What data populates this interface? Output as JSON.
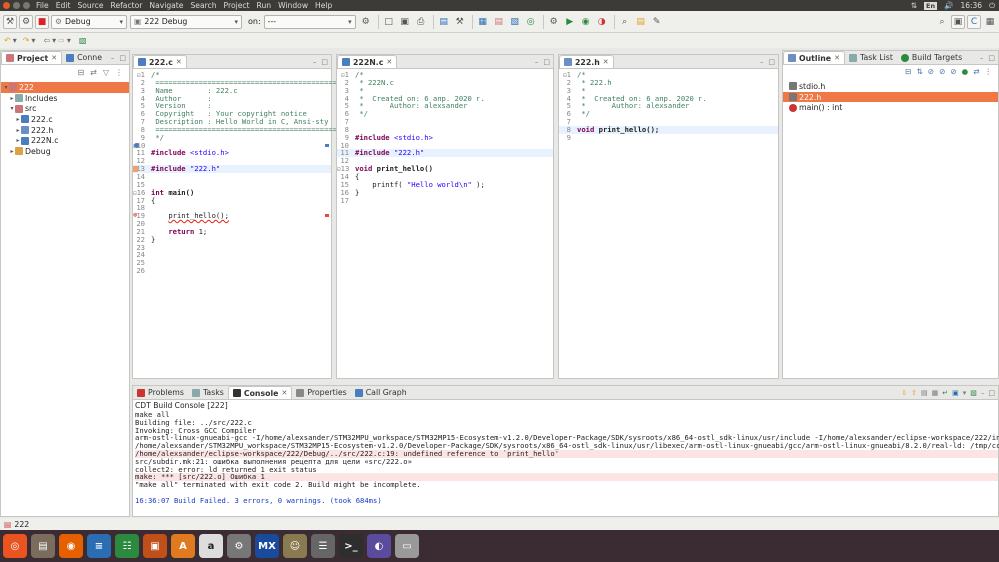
{
  "menubar": {
    "items": [
      "File",
      "Edit",
      "Source",
      "Refactor",
      "Navigate",
      "Search",
      "Project",
      "Run",
      "Window",
      "Help"
    ],
    "keyboard": "En",
    "clock": "16:36"
  },
  "toolbar": {
    "build_config": "Debug",
    "launch_config": "222 Debug",
    "on_label": "on:",
    "on_value": "---"
  },
  "project_panel": {
    "tabs": [
      {
        "label": "Project"
      },
      {
        "label": "Conne"
      }
    ],
    "tree": [
      {
        "label": "222",
        "depth": 0,
        "twisty": "▾",
        "selected": true,
        "icon": "project-icon"
      },
      {
        "label": "Includes",
        "depth": 1,
        "twisty": "▸",
        "icon": "includes-icon"
      },
      {
        "label": "src",
        "depth": 1,
        "twisty": "▾",
        "icon": "source-folder-icon"
      },
      {
        "label": "222.c",
        "depth": 2,
        "twisty": "▸",
        "icon": "c-file-error-icon"
      },
      {
        "label": "222.h",
        "depth": 2,
        "twisty": "▸",
        "icon": "h-file-icon"
      },
      {
        "label": "222N.c",
        "depth": 2,
        "twisty": "▸",
        "icon": "c-file-icon"
      },
      {
        "label": "Debug",
        "depth": 1,
        "twisty": "▸",
        "icon": "folder-icon"
      }
    ]
  },
  "editors": [
    {
      "tab": "222.c",
      "lines": [
        {
          "n": "1",
          "t": "/*",
          "c": "cm",
          "fold": true
        },
        {
          "n": "2",
          "t": " ============================================",
          "c": "cm"
        },
        {
          "n": "3",
          "t": " Name        : 222.c",
          "c": "cm"
        },
        {
          "n": "4",
          "t": " Author      :",
          "c": "cm"
        },
        {
          "n": "5",
          "t": " Version     :",
          "c": "cm"
        },
        {
          "n": "6",
          "t": " Copyright   : Your copyright notice",
          "c": "cm"
        },
        {
          "n": "7",
          "t": " Description : Hello World in C, Ansi-sty",
          "c": "cm"
        },
        {
          "n": "8",
          "t": " ============================================",
          "c": "cm"
        },
        {
          "n": "9",
          "t": " */",
          "c": "cm"
        },
        {
          "n": "10",
          "t": "",
          "c": "",
          "fold": true
        },
        {
          "n": "11",
          "t": "#include <stdio.h>",
          "c": "inc"
        },
        {
          "n": "12",
          "t": "",
          "c": ""
        },
        {
          "n": "13",
          "t": "#include \"222.h\"",
          "c": "inc",
          "hl": true
        },
        {
          "n": "14",
          "t": "",
          "c": ""
        },
        {
          "n": "15",
          "t": "",
          "c": ""
        },
        {
          "n": "16",
          "t": "int main()",
          "c": "main",
          "fold": true
        },
        {
          "n": "17",
          "t": "{",
          "c": ""
        },
        {
          "n": "18",
          "t": "",
          "c": ""
        },
        {
          "n": "19",
          "t": "    print_hello();",
          "c": "err"
        },
        {
          "n": "20",
          "t": "",
          "c": ""
        },
        {
          "n": "21",
          "t": "    return 1;",
          "c": "ret"
        },
        {
          "n": "22",
          "t": "}",
          "c": ""
        },
        {
          "n": "23",
          "t": "",
          "c": ""
        },
        {
          "n": "24",
          "t": "",
          "c": ""
        },
        {
          "n": "25",
          "t": "",
          "c": ""
        },
        {
          "n": "26",
          "t": "",
          "c": ""
        }
      ]
    },
    {
      "tab": "222N.c",
      "lines": [
        {
          "n": "1",
          "t": "/*",
          "c": "cm",
          "fold": true
        },
        {
          "n": "2",
          "t": " * 222N.c",
          "c": "cm"
        },
        {
          "n": "3",
          "t": " *",
          "c": "cm"
        },
        {
          "n": "4",
          "t": " *  Created on: 6 апр. 2020 г.",
          "c": "cm"
        },
        {
          "n": "5",
          "t": " *      Author: alexsander",
          "c": "cm"
        },
        {
          "n": "6",
          "t": " */",
          "c": "cm"
        },
        {
          "n": "7",
          "t": "",
          "c": ""
        },
        {
          "n": "8",
          "t": "",
          "c": ""
        },
        {
          "n": "9",
          "t": "#include <stdio.h>",
          "c": "inc"
        },
        {
          "n": "10",
          "t": "",
          "c": ""
        },
        {
          "n": "11",
          "t": "#include \"222.h\"",
          "c": "inc",
          "hl": true
        },
        {
          "n": "12",
          "t": "",
          "c": ""
        },
        {
          "n": "13",
          "t": "void print_hello()",
          "c": "void",
          "fold": true
        },
        {
          "n": "14",
          "t": "{",
          "c": ""
        },
        {
          "n": "15",
          "t": "    printf( \"Hello world\\n\" );",
          "c": "printf"
        },
        {
          "n": "16",
          "t": "}",
          "c": ""
        },
        {
          "n": "17",
          "t": "",
          "c": ""
        }
      ]
    },
    {
      "tab": "222.h",
      "lines": [
        {
          "n": "1",
          "t": "/*",
          "c": "cm",
          "fold": true
        },
        {
          "n": "2",
          "t": " * 222.h",
          "c": "cm"
        },
        {
          "n": "3",
          "t": " *",
          "c": "cm"
        },
        {
          "n": "4",
          "t": " *  Created on: 6 апр. 2020 г.",
          "c": "cm"
        },
        {
          "n": "5",
          "t": " *      Author: alexsander",
          "c": "cm"
        },
        {
          "n": "6",
          "t": " */",
          "c": "cm"
        },
        {
          "n": "7",
          "t": "",
          "c": ""
        },
        {
          "n": "8",
          "t": "void print_hello();",
          "c": "void",
          "hl": true
        },
        {
          "n": "9",
          "t": "",
          "c": ""
        }
      ]
    }
  ],
  "outline": {
    "tabs": [
      {
        "label": "Outline"
      },
      {
        "label": "Task List"
      },
      {
        "label": "Build Targets"
      }
    ],
    "items": [
      {
        "label": "stdio.h",
        "selected": false
      },
      {
        "label": "222.h",
        "selected": true
      },
      {
        "label": "main() : int",
        "selected": false
      }
    ]
  },
  "console": {
    "tabs": [
      {
        "label": "Problems"
      },
      {
        "label": "Tasks"
      },
      {
        "label": "Console"
      },
      {
        "label": "Properties"
      },
      {
        "label": "Call Graph"
      }
    ],
    "title": "CDT Build Console [222]",
    "lines": [
      {
        "t": "make all",
        "k": ""
      },
      {
        "t": "Building file: ../src/222.c",
        "k": ""
      },
      {
        "t": "Invoking: Cross GCC Compiler",
        "k": ""
      },
      {
        "t": "arm-ostl-linux-gnueabi-gcc -I/home/alexsander/STM32MPU_workspace/STM32MP15-Ecosystem-v1.2.0/Developer-Package/SDK/sysroots/x86_64-ostl_sdk-linux/usr/include -I/home/alexsander/eclipse-workspace/222/inc -O0",
        "k": ""
      },
      {
        "t": "/home/alexsander/STM32MPU_workspace/STM32MP15-Ecosystem-v1.2.0/Developer-Package/SDK/sysroots/x86_64-ostl_sdk-linux/usr/libexec/arm-ostl-linux-gnueabi/gcc/arm-ostl-linux-gnueabi/8.2.0/real-ld: /tmp/ccjqhYEe",
        "k": ""
      },
      {
        "t": "/home/alexsander/eclipse-workspace/222/Debug/../src/222.c:19: undefined reference to `print_hello'",
        "k": "err"
      },
      {
        "t": "src/subdir.mk:21: ошибка выполнения рецепта для цели «src/222.o»",
        "k": ""
      },
      {
        "t": "collect2: error: ld returned 1 exit status",
        "k": ""
      },
      {
        "t": "make: *** [src/222.o] Ошибка 1",
        "k": "err"
      },
      {
        "t": "\"make all\" terminated with exit code 2. Build might be incomplete.",
        "k": ""
      },
      {
        "t": "",
        "k": ""
      },
      {
        "t": "16:36:07 Build Failed. 3 errors, 0 warnings. (took 684ms)",
        "k": "blue"
      }
    ]
  },
  "status": {
    "text": "222"
  },
  "taskbar": {
    "apps": [
      {
        "name": "ubuntu-icon",
        "color": "#e95420",
        "glyph": "◎"
      },
      {
        "name": "files-icon",
        "color": "#7a6d5e",
        "glyph": "▤"
      },
      {
        "name": "firefox-icon",
        "color": "#e66000",
        "glyph": "◉"
      },
      {
        "name": "writer-icon",
        "color": "#2a6db3",
        "glyph": "≡"
      },
      {
        "name": "calc-icon",
        "color": "#2b8a3e",
        "glyph": "☷"
      },
      {
        "name": "impress-icon",
        "color": "#c0501a",
        "glyph": "▣"
      },
      {
        "name": "software-icon",
        "color": "#e07a1f",
        "glyph": "A"
      },
      {
        "name": "amazon-icon",
        "color": "#ddd",
        "glyph": "a"
      },
      {
        "name": "settings-icon",
        "color": "#777",
        "glyph": "⚙"
      },
      {
        "name": "stm32cube-icon",
        "color": "#1a4a9c",
        "glyph": "MX"
      },
      {
        "name": "gimp-icon",
        "color": "#8a7a50",
        "glyph": "☺"
      },
      {
        "name": "calculator-icon",
        "color": "#666",
        "glyph": "☰"
      },
      {
        "name": "terminal-icon",
        "color": "#2e2e2e",
        "glyph": ">_"
      },
      {
        "name": "eclipse-icon",
        "color": "#5b4b9c",
        "glyph": "◐"
      },
      {
        "name": "drive-icon",
        "color": "#999",
        "glyph": "▭"
      }
    ]
  },
  "colors": {
    "selection": "#f07746",
    "accent_blue": "#1a39c8",
    "error_bg": "#fde4e4"
  }
}
